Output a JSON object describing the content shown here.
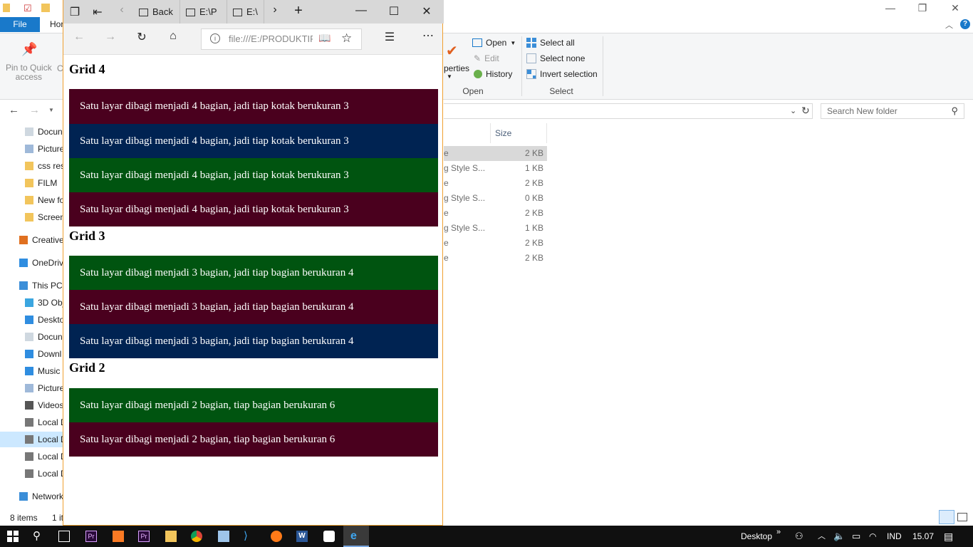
{
  "explorer": {
    "ribbon_tab_file": "File",
    "ribbon_tab_home": "Hor",
    "pin_label_line1": "Pin to Quick",
    "pin_label_line2": "access",
    "copy_label": "C",
    "properties_label": "perties",
    "open_label": "Open",
    "edit_label": "Edit",
    "history_label": "History",
    "open_group": "Open",
    "select_all": "Select all",
    "select_none": "Select none",
    "invert_selection": "Invert selection",
    "select_group": "Select",
    "search_placeholder": "Search New folder",
    "size_column": "Size",
    "nav_items": [
      "Docun",
      "Picture",
      "css res",
      "FILM",
      "New fo",
      "Screen",
      "Creative",
      "OneDriv",
      "This PC",
      "3D Obj",
      "Deskto",
      "Docun",
      "Downl",
      "Music",
      "Picture",
      "Videos",
      "Local D",
      "Local D",
      "Local D",
      "Local D",
      "Network"
    ],
    "files": [
      {
        "name": "e",
        "size": "2 KB"
      },
      {
        "name": "g Style S...",
        "size": "1 KB"
      },
      {
        "name": "e",
        "size": "2 KB"
      },
      {
        "name": "g Style S...",
        "size": "0 KB"
      },
      {
        "name": "e",
        "size": "2 KB"
      },
      {
        "name": "g Style S...",
        "size": "1 KB"
      },
      {
        "name": "e",
        "size": "2 KB"
      },
      {
        "name": "e",
        "size": "2 KB"
      }
    ],
    "status_items": "8 items",
    "status_selected": "1 it"
  },
  "edge": {
    "tabs": [
      "Back",
      "E:\\P",
      "E:\\"
    ],
    "url": "file:///E:/PRODUKTIF"
  },
  "page": {
    "sections": [
      {
        "heading": "Grid 4",
        "blocks": [
          {
            "text": "Satu layar dibagi menjadi 4 bagian, jadi tiap kotak berukuran 3",
            "color": "#4a001e"
          },
          {
            "text": "Satu layar dibagi menjadi 4 bagian, jadi tiap kotak berukuran 3",
            "color": "#002352"
          },
          {
            "text": "Satu layar dibagi menjadi 4 bagian, jadi tiap kotak berukuran 3",
            "color": "#005410"
          },
          {
            "text": "Satu layar dibagi menjadi 4 bagian, jadi tiap kotak berukuran 3",
            "color": "#4a001e"
          }
        ]
      },
      {
        "heading": "Grid 3",
        "blocks": [
          {
            "text": "Satu layar dibagi menjadi 3 bagian, jadi tiap bagian berukuran 4",
            "color": "#005410"
          },
          {
            "text": "Satu layar dibagi menjadi 3 bagian, jadi tiap bagian berukuran 4",
            "color": "#4a001e"
          },
          {
            "text": "Satu layar dibagi menjadi 3 bagian, jadi tiap bagian berukuran 4",
            "color": "#002352"
          }
        ]
      },
      {
        "heading": "Grid 2",
        "blocks": [
          {
            "text": "Satu layar dibagi menjadi 2 bagian, tiap bagian berukuran 6",
            "color": "#005410"
          },
          {
            "text": "Satu layar dibagi menjadi 2 bagian, tiap bagian berukuran 6",
            "color": "#4a001e"
          }
        ]
      }
    ]
  },
  "taskbar": {
    "desktop_label": "Desktop",
    "language": "IND",
    "time": "15.07"
  }
}
